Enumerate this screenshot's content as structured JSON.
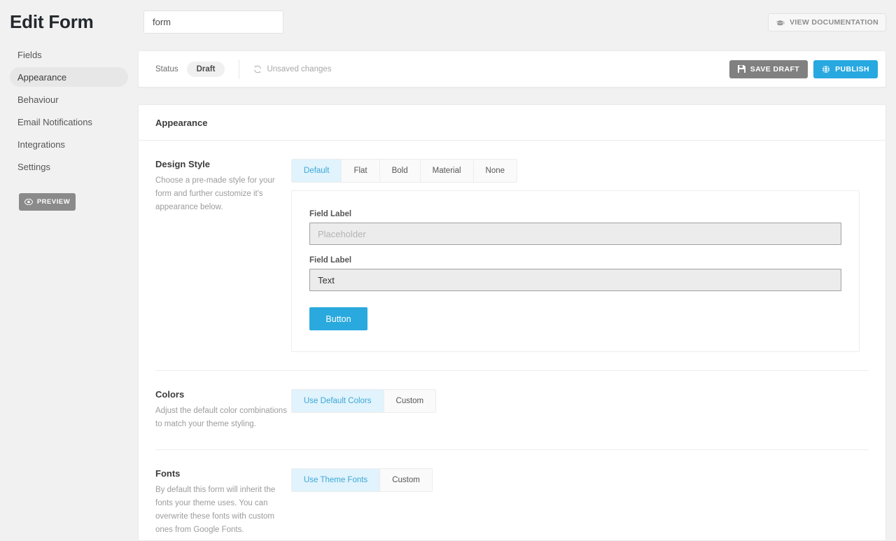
{
  "header": {
    "title": "Edit Form",
    "form_name_value": "form",
    "form_name_placeholder": "",
    "documentation_button": "VIEW DOCUMENTATION",
    "documentation_icon": "book-icon"
  },
  "sidebar": {
    "items": [
      {
        "label": "Fields",
        "active": false
      },
      {
        "label": "Appearance",
        "active": true
      },
      {
        "label": "Behaviour",
        "active": false
      },
      {
        "label": "Email Notifications",
        "active": false
      },
      {
        "label": "Integrations",
        "active": false
      },
      {
        "label": "Settings",
        "active": false
      }
    ],
    "preview_button": "PREVIEW",
    "preview_icon": "eye-icon"
  },
  "statusbar": {
    "status_label": "Status",
    "status_value": "Draft",
    "unsaved_text": "Unsaved changes",
    "unsaved_icon": "refresh-icon",
    "save_draft_label": "SAVE DRAFT",
    "save_draft_icon": "floppy-disk-icon",
    "publish_label": "PUBLISH",
    "publish_icon": "globe-icon"
  },
  "panel": {
    "title": "Appearance"
  },
  "design_style": {
    "title": "Design Style",
    "description": "Choose a pre-made style for your form and further customize it's appearance below.",
    "options": [
      {
        "label": "Default",
        "active": true
      },
      {
        "label": "Flat",
        "active": false
      },
      {
        "label": "Bold",
        "active": false
      },
      {
        "label": "Material",
        "active": false
      },
      {
        "label": "None",
        "active": false
      }
    ],
    "preview": {
      "field_one_label": "Field Label",
      "field_one_placeholder": "Placeholder",
      "field_one_value": "",
      "field_two_label": "Field Label",
      "field_two_placeholder": "",
      "field_two_value": "Text",
      "submit_label": "Button"
    }
  },
  "colors": {
    "title": "Colors",
    "description": "Adjust the default color combinations to match your theme styling.",
    "options": [
      {
        "label": "Use Default Colors",
        "active": true
      },
      {
        "label": "Custom",
        "active": false
      }
    ]
  },
  "fonts": {
    "title": "Fonts",
    "description": "By default this form will inherit the fonts your theme uses. You can overwrite these fonts with custom ones from Google Fonts.",
    "options": [
      {
        "label": "Use Theme Fonts",
        "active": true
      },
      {
        "label": "Custom",
        "active": false
      }
    ]
  },
  "colors_palette": {
    "accent_blue": "#29a9dd",
    "active_tab_bg": "#e1f3fc",
    "active_tab_text": "#3ba7d8",
    "page_bg": "#f1f1f1",
    "save_draft_grey": "#808080",
    "preview_btn_grey": "#8a8a8a"
  }
}
